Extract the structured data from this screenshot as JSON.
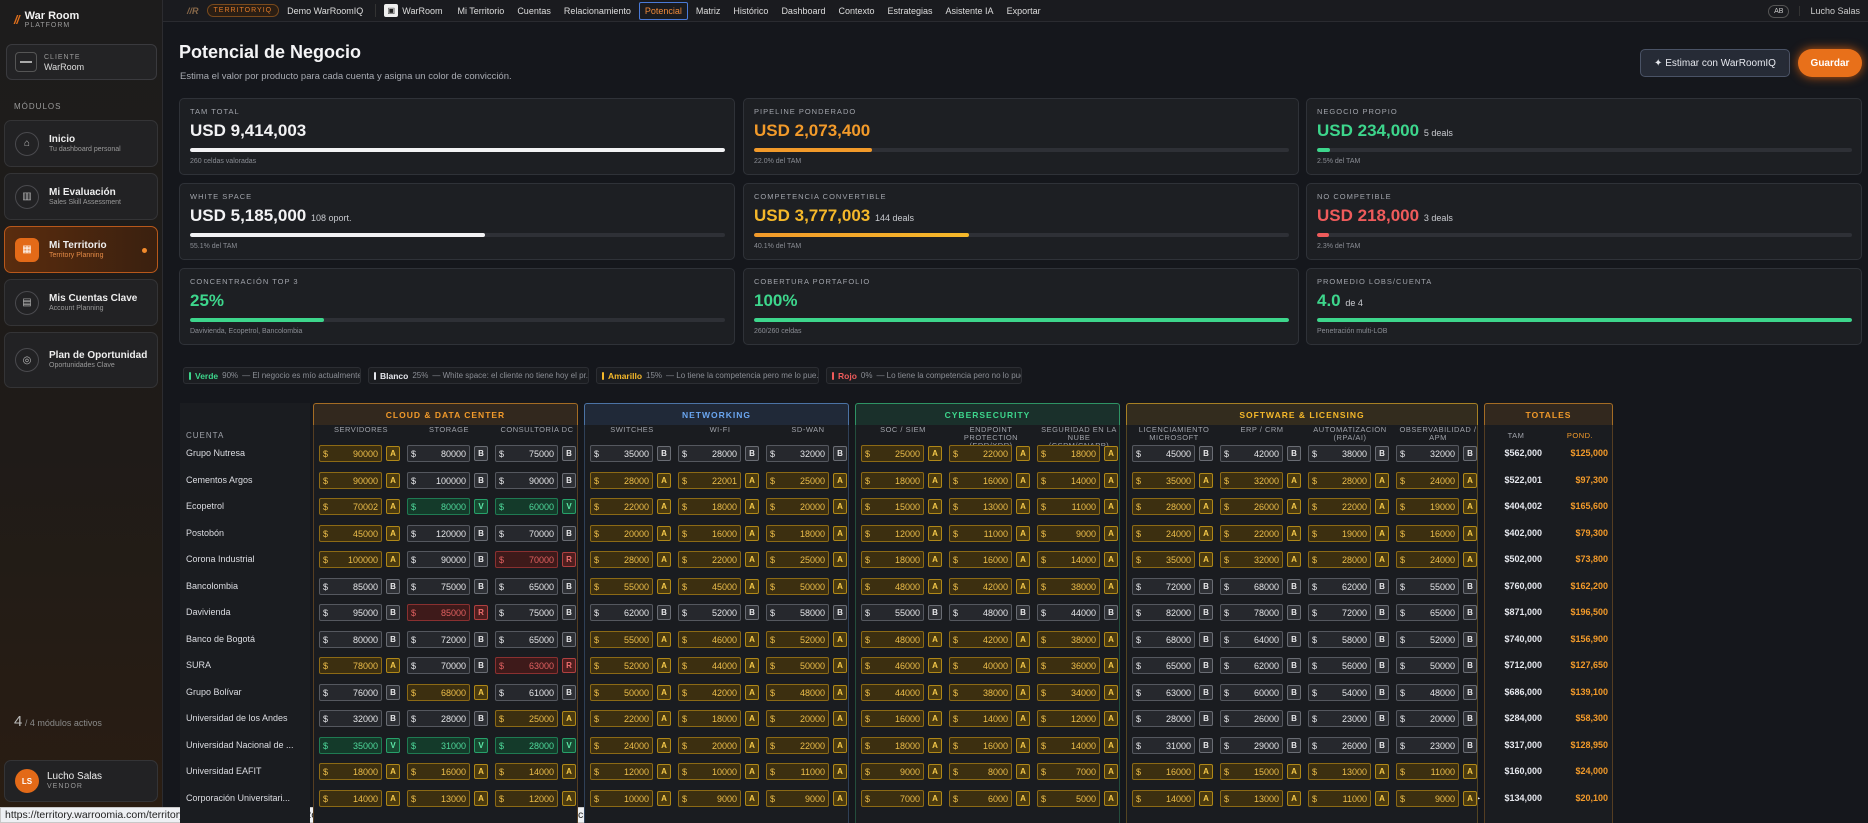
{
  "brand": {
    "title": "War Room",
    "subtitle": "PLATFORM"
  },
  "client": {
    "label": "CLIENTE",
    "value": "WarRoom"
  },
  "modules_title": "MÓDULOS",
  "nav": [
    {
      "label": "Inicio",
      "sub": "Tu dashboard personal",
      "icon": "home-icon",
      "glyph": "⌂"
    },
    {
      "label": "Mi Evaluación",
      "sub": "Sales Skill Assessment",
      "icon": "chart-icon",
      "glyph": "▥"
    },
    {
      "label": "Mi Territorio",
      "sub": "Territory Planning",
      "icon": "map-icon",
      "glyph": "▦"
    },
    {
      "label": "Mis Cuentas Clave",
      "sub": "Account Planning",
      "icon": "building-icon",
      "glyph": "▤"
    },
    {
      "label": "Plan de Oportunidad",
      "sub": "Oportunidades Clave",
      "icon": "target-icon",
      "glyph": "◎"
    }
  ],
  "modules_count": {
    "n": "4",
    "text": "/ 4 módulos activos"
  },
  "user": {
    "initials": "LS",
    "name": "Lucho Salas",
    "role": "VENDOR"
  },
  "topbar": {
    "badge": "TERRITORYIQ",
    "demo": "Demo WarRoomIQ",
    "workspace": "WarRoom",
    "tabs": [
      "Mi Territorio",
      "Cuentas",
      "Relacionamiento",
      "Potencial",
      "Matriz",
      "Histórico",
      "Dashboard",
      "Contexto",
      "Estrategias",
      "Asistente IA",
      "Exportar"
    ],
    "active_tab": "Potencial",
    "user_initials": "AB",
    "user_name": "Lucho Salas"
  },
  "page": {
    "title": "Potencial de Negocio",
    "subtitle": "Estima el valor por producto para cada cuenta y asigna un color de convicción.",
    "estimate_btn": "✦ Estimar con WarRoomIQ",
    "save_btn": "Guardar"
  },
  "kpis": [
    {
      "label": "TAM TOTAL",
      "value": "USD 9,414,003",
      "extra": "",
      "foot": "260 celdas valoradas",
      "color": "#f2f2f4",
      "fill": 1.0
    },
    {
      "label": "PIPELINE PONDERADO",
      "value": "USD 2,073,400",
      "extra": "",
      "foot": "22.0% del TAM",
      "color": "#f29a2a",
      "fill": 0.22
    },
    {
      "label": "NEGOCIO PROPIO",
      "value": "USD 234,000",
      "extra": "5 deals",
      "foot": "2.5% del TAM",
      "color": "#3dd68c",
      "fill": 0.025
    },
    {
      "label": "WHITE SPACE",
      "value": "USD 5,185,000",
      "extra": "108 oport.",
      "foot": "55.1% del TAM",
      "color": "#f2f2f4",
      "fill": 0.551
    },
    {
      "label": "COMPETENCIA CONVERTIBLE",
      "value": "USD 3,777,003",
      "extra": "144 deals",
      "foot": "40.1% del TAM",
      "color": "#f5b82a",
      "fill": 0.401
    },
    {
      "label": "NO COMPETIBLE",
      "value": "USD 218,000",
      "extra": "3 deals",
      "foot": "2.3% del TAM",
      "color": "#ef5b5b",
      "fill": 0.023
    },
    {
      "label": "CONCENTRACIÓN TOP 3",
      "value": "25%",
      "extra": "",
      "foot": "Davivienda, Ecopetrol, Bancolombia",
      "color": "#3dd68c",
      "fill": 0.25
    },
    {
      "label": "COBERTURA PORTAFOLIO",
      "value": "100%",
      "extra": "",
      "foot": "260/260 celdas",
      "color": "#3dd68c",
      "fill": 1.0
    },
    {
      "label": "PROMEDIO LOBS/CUENTA",
      "value": "4.0",
      "extra": "de 4",
      "foot": "Penetración multi-LOB",
      "color": "#3dd68c",
      "fill": 1.0
    }
  ],
  "legend": [
    {
      "name": "Verde",
      "pct": "90%",
      "desc": "— El negocio es mío actualmente",
      "color": "#3dd68c"
    },
    {
      "name": "Blanco",
      "pct": "25%",
      "desc": "— White space: el cliente no tiene hoy el pr...",
      "color": "#e6e8ee"
    },
    {
      "name": "Amarillo",
      "pct": "15%",
      "desc": "— Lo tiene la competencia pero me lo pue...",
      "color": "#f5b82a"
    },
    {
      "name": "Rojo",
      "pct": "0%",
      "desc": "— Lo tiene la competencia pero no lo pued...",
      "color": "#ef5b5b"
    }
  ],
  "table": {
    "account_header": "CUENTA",
    "groups": [
      {
        "name": "CLOUD & DATA CENTER",
        "color": "#f29a2a",
        "cols": [
          "SERVIDORES",
          "STORAGE",
          "CONSULTORÍA DC"
        ]
      },
      {
        "name": "NETWORKING",
        "color": "#6aa6f0",
        "cols": [
          "SWITCHES",
          "WI-FI",
          "SD-WAN"
        ]
      },
      {
        "name": "CYBERSECURITY",
        "color": "#3dd68c",
        "cols": [
          "SOC / SIEM",
          "ENDPOINT PROTECTION (EDR/XDR)",
          "SEGURIDAD EN LA NUBE (CSPM/CNAPP)"
        ]
      },
      {
        "name": "SOFTWARE & LICENSING",
        "color": "#f5b82a",
        "cols": [
          "LICENCIAMIENTO MICROSOFT",
          "ERP / CRM",
          "AUTOMATIZACIÓN (RPA/AI)",
          "OBSERVABILIDAD / APM"
        ]
      }
    ],
    "totals_title": "TOTALES",
    "totals_cols": [
      "TAM",
      "POND."
    ],
    "rows": [
      {
        "account": "Grupo Nutresa",
        "cells": [
          [
            "90000",
            "A"
          ],
          [
            "80000",
            "B"
          ],
          [
            "75000",
            "B"
          ],
          [
            "35000",
            "B"
          ],
          [
            "28000",
            "B"
          ],
          [
            "32000",
            "B"
          ],
          [
            "25000",
            "A"
          ],
          [
            "22000",
            "A"
          ],
          [
            "18000",
            "A"
          ],
          [
            "45000",
            "B"
          ],
          [
            "42000",
            "B"
          ],
          [
            "38000",
            "B"
          ],
          [
            "32000",
            "B"
          ]
        ],
        "tam": "$562,000",
        "pond": "$125,000"
      },
      {
        "account": "Cementos Argos",
        "cells": [
          [
            "90000",
            "A"
          ],
          [
            "100000",
            "B"
          ],
          [
            "90000",
            "B"
          ],
          [
            "28000",
            "A"
          ],
          [
            "22001",
            "A"
          ],
          [
            "25000",
            "A"
          ],
          [
            "18000",
            "A"
          ],
          [
            "16000",
            "A"
          ],
          [
            "14000",
            "A"
          ],
          [
            "35000",
            "A"
          ],
          [
            "32000",
            "A"
          ],
          [
            "28000",
            "A"
          ],
          [
            "24000",
            "A"
          ]
        ],
        "tam": "$522,001",
        "pond": "$97,300"
      },
      {
        "account": "Ecopetrol",
        "cells": [
          [
            "70002",
            "A"
          ],
          [
            "80000",
            "V"
          ],
          [
            "60000",
            "V"
          ],
          [
            "22000",
            "A"
          ],
          [
            "18000",
            "A"
          ],
          [
            "20000",
            "A"
          ],
          [
            "15000",
            "A"
          ],
          [
            "13000",
            "A"
          ],
          [
            "11000",
            "A"
          ],
          [
            "28000",
            "A"
          ],
          [
            "26000",
            "A"
          ],
          [
            "22000",
            "A"
          ],
          [
            "19000",
            "A"
          ]
        ],
        "tam": "$404,002",
        "pond": "$165,600"
      },
      {
        "account": "Postobón",
        "cells": [
          [
            "45000",
            "A"
          ],
          [
            "120000",
            "B"
          ],
          [
            "70000",
            "B"
          ],
          [
            "20000",
            "A"
          ],
          [
            "16000",
            "A"
          ],
          [
            "18000",
            "A"
          ],
          [
            "12000",
            "A"
          ],
          [
            "11000",
            "A"
          ],
          [
            "9000",
            "A"
          ],
          [
            "24000",
            "A"
          ],
          [
            "22000",
            "A"
          ],
          [
            "19000",
            "A"
          ],
          [
            "16000",
            "A"
          ]
        ],
        "tam": "$402,000",
        "pond": "$79,300"
      },
      {
        "account": "Corona Industrial",
        "cells": [
          [
            "100000",
            "A"
          ],
          [
            "90000",
            "B"
          ],
          [
            "70000",
            "R"
          ],
          [
            "28000",
            "A"
          ],
          [
            "22000",
            "A"
          ],
          [
            "25000",
            "A"
          ],
          [
            "18000",
            "A"
          ],
          [
            "16000",
            "A"
          ],
          [
            "14000",
            "A"
          ],
          [
            "35000",
            "A"
          ],
          [
            "32000",
            "A"
          ],
          [
            "28000",
            "A"
          ],
          [
            "24000",
            "A"
          ]
        ],
        "tam": "$502,000",
        "pond": "$73,800"
      },
      {
        "account": "Bancolombia",
        "cells": [
          [
            "85000",
            "B"
          ],
          [
            "75000",
            "B"
          ],
          [
            "65000",
            "B"
          ],
          [
            "55000",
            "A"
          ],
          [
            "45000",
            "A"
          ],
          [
            "50000",
            "A"
          ],
          [
            "48000",
            "A"
          ],
          [
            "42000",
            "A"
          ],
          [
            "38000",
            "A"
          ],
          [
            "72000",
            "B"
          ],
          [
            "68000",
            "B"
          ],
          [
            "62000",
            "B"
          ],
          [
            "55000",
            "B"
          ]
        ],
        "tam": "$760,000",
        "pond": "$162,200"
      },
      {
        "account": "Davivienda",
        "cells": [
          [
            "95000",
            "B"
          ],
          [
            "85000",
            "R"
          ],
          [
            "75000",
            "B"
          ],
          [
            "62000",
            "B"
          ],
          [
            "52000",
            "B"
          ],
          [
            "58000",
            "B"
          ],
          [
            "55000",
            "B"
          ],
          [
            "48000",
            "B"
          ],
          [
            "44000",
            "B"
          ],
          [
            "82000",
            "B"
          ],
          [
            "78000",
            "B"
          ],
          [
            "72000",
            "B"
          ],
          [
            "65000",
            "B"
          ]
        ],
        "tam": "$871,000",
        "pond": "$196,500"
      },
      {
        "account": "Banco de Bogotá",
        "cells": [
          [
            "80000",
            "B"
          ],
          [
            "72000",
            "B"
          ],
          [
            "65000",
            "B"
          ],
          [
            "55000",
            "A"
          ],
          [
            "46000",
            "A"
          ],
          [
            "52000",
            "A"
          ],
          [
            "48000",
            "A"
          ],
          [
            "42000",
            "A"
          ],
          [
            "38000",
            "A"
          ],
          [
            "68000",
            "B"
          ],
          [
            "64000",
            "B"
          ],
          [
            "58000",
            "B"
          ],
          [
            "52000",
            "B"
          ]
        ],
        "tam": "$740,000",
        "pond": "$156,900"
      },
      {
        "account": "SURA",
        "cells": [
          [
            "78000",
            "A"
          ],
          [
            "70000",
            "B"
          ],
          [
            "63000",
            "R"
          ],
          [
            "52000",
            "A"
          ],
          [
            "44000",
            "A"
          ],
          [
            "50000",
            "A"
          ],
          [
            "46000",
            "A"
          ],
          [
            "40000",
            "A"
          ],
          [
            "36000",
            "A"
          ],
          [
            "65000",
            "B"
          ],
          [
            "62000",
            "B"
          ],
          [
            "56000",
            "B"
          ],
          [
            "50000",
            "B"
          ]
        ],
        "tam": "$712,000",
        "pond": "$127,650"
      },
      {
        "account": "Grupo Bolívar",
        "cells": [
          [
            "76000",
            "B"
          ],
          [
            "68000",
            "A"
          ],
          [
            "61000",
            "B"
          ],
          [
            "50000",
            "A"
          ],
          [
            "42000",
            "A"
          ],
          [
            "48000",
            "A"
          ],
          [
            "44000",
            "A"
          ],
          [
            "38000",
            "A"
          ],
          [
            "34000",
            "A"
          ],
          [
            "63000",
            "B"
          ],
          [
            "60000",
            "B"
          ],
          [
            "54000",
            "B"
          ],
          [
            "48000",
            "B"
          ]
        ],
        "tam": "$686,000",
        "pond": "$139,100"
      },
      {
        "account": "Universidad de los Andes",
        "cells": [
          [
            "32000",
            "B"
          ],
          [
            "28000",
            "B"
          ],
          [
            "25000",
            "A"
          ],
          [
            "22000",
            "A"
          ],
          [
            "18000",
            "A"
          ],
          [
            "20000",
            "A"
          ],
          [
            "16000",
            "A"
          ],
          [
            "14000",
            "A"
          ],
          [
            "12000",
            "A"
          ],
          [
            "28000",
            "B"
          ],
          [
            "26000",
            "B"
          ],
          [
            "23000",
            "B"
          ],
          [
            "20000",
            "B"
          ]
        ],
        "tam": "$284,000",
        "pond": "$58,300"
      },
      {
        "account": "Universidad Nacional de ...",
        "cells": [
          [
            "35000",
            "V"
          ],
          [
            "31000",
            "V"
          ],
          [
            "28000",
            "V"
          ],
          [
            "24000",
            "A"
          ],
          [
            "20000",
            "A"
          ],
          [
            "22000",
            "A"
          ],
          [
            "18000",
            "A"
          ],
          [
            "16000",
            "A"
          ],
          [
            "14000",
            "A"
          ],
          [
            "31000",
            "B"
          ],
          [
            "29000",
            "B"
          ],
          [
            "26000",
            "B"
          ],
          [
            "23000",
            "B"
          ]
        ],
        "tam": "$317,000",
        "pond": "$128,950"
      },
      {
        "account": "Universidad EAFIT",
        "cells": [
          [
            "18000",
            "A"
          ],
          [
            "16000",
            "A"
          ],
          [
            "14000",
            "A"
          ],
          [
            "12000",
            "A"
          ],
          [
            "10000",
            "A"
          ],
          [
            "11000",
            "A"
          ],
          [
            "9000",
            "A"
          ],
          [
            "8000",
            "A"
          ],
          [
            "7000",
            "A"
          ],
          [
            "16000",
            "A"
          ],
          [
            "15000",
            "A"
          ],
          [
            "13000",
            "A"
          ],
          [
            "11000",
            "A"
          ]
        ],
        "tam": "$160,000",
        "pond": "$24,000"
      },
      {
        "account": "Corporación Universitari...",
        "cells": [
          [
            "14000",
            "A"
          ],
          [
            "13000",
            "A"
          ],
          [
            "12000",
            "A"
          ],
          [
            "10000",
            "A"
          ],
          [
            "9000",
            "A"
          ],
          [
            "9000",
            "A"
          ],
          [
            "7000",
            "A"
          ],
          [
            "6000",
            "A"
          ],
          [
            "5000",
            "A"
          ],
          [
            "14000",
            "A"
          ],
          [
            "13000",
            "A"
          ],
          [
            "11000",
            "A"
          ],
          [
            "9000",
            "A"
          ]
        ],
        "tam": "$134,000",
        "pond": "$20,100"
      }
    ]
  },
  "status_url": "https://territory.warroomia.com/territory/525dc1fc56586ace952342eacc96a86612c5a8f55d1d39415a159322b4e488f1/potencial"
}
